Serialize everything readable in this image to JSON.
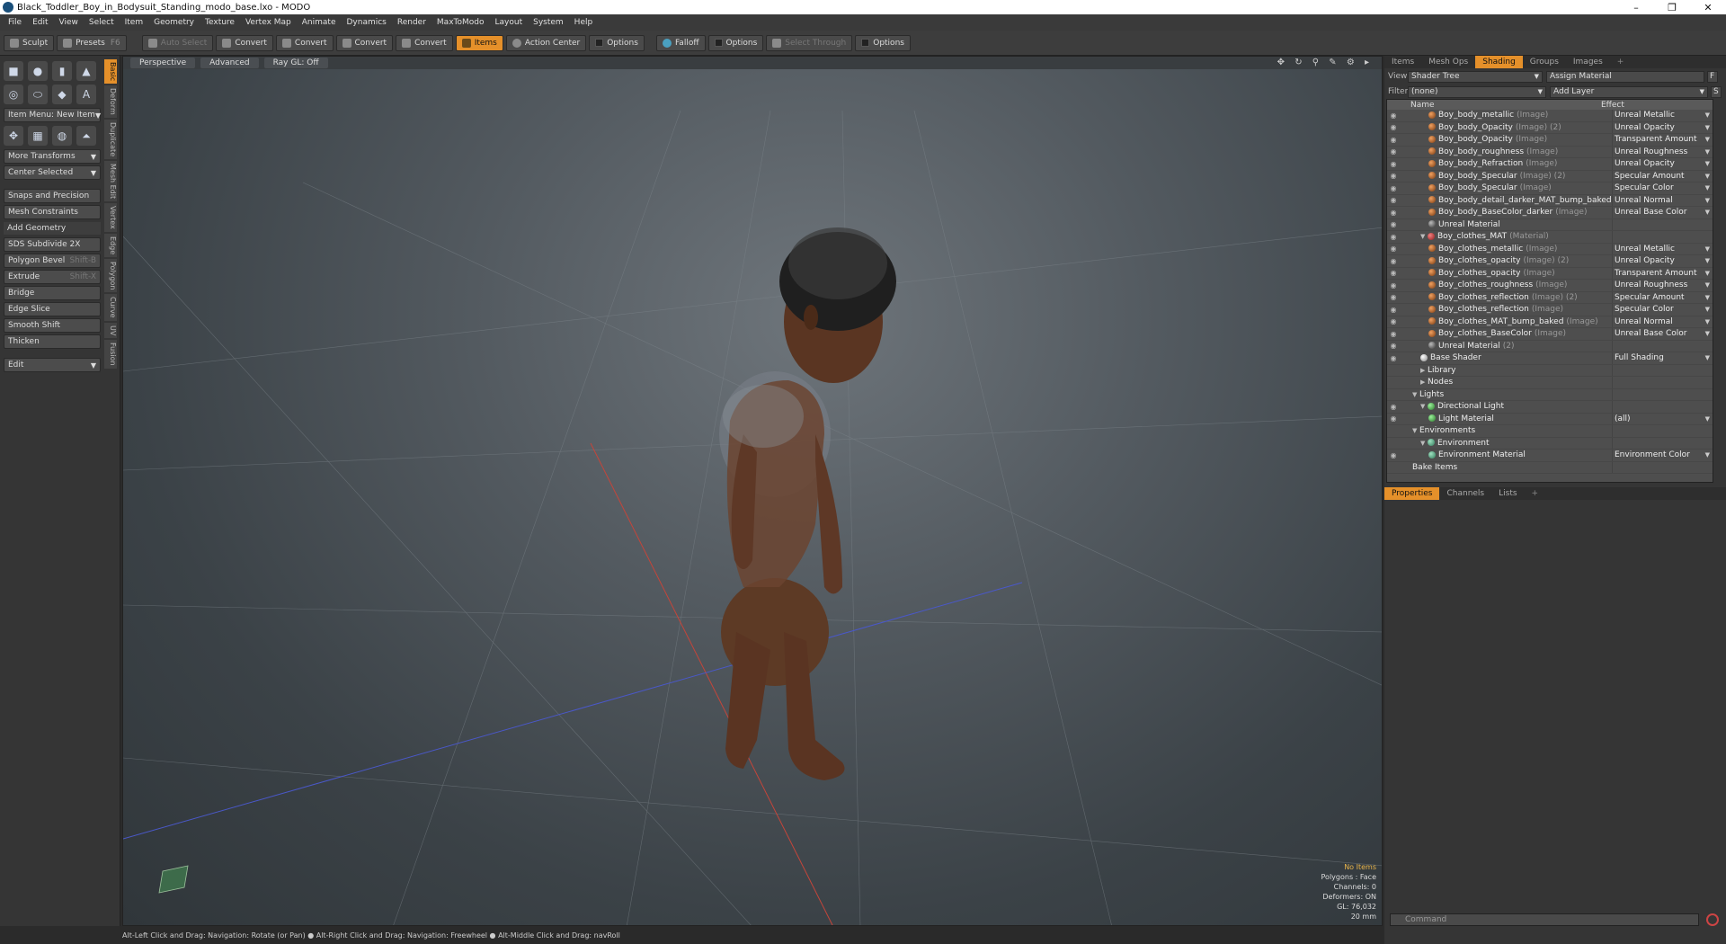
{
  "window": {
    "title": "Black_Toddler_Boy_in_Bodysuit_Standing_modo_base.lxo - MODO",
    "min": "–",
    "max": "❐",
    "close": "✕"
  },
  "menu": [
    "File",
    "Edit",
    "View",
    "Select",
    "Item",
    "Geometry",
    "Texture",
    "Vertex Map",
    "Animate",
    "Dynamics",
    "Render",
    "MaxToModo",
    "Layout",
    "System",
    "Help"
  ],
  "toolbar": {
    "sculpt": "Sculpt",
    "presets": "Presets",
    "presets_key": "F6",
    "auto_select": "Auto Select",
    "convert1": "Convert",
    "convert2": "Convert",
    "convert3": "Convert",
    "convert4": "Convert",
    "items": "Items",
    "action_center": "Action Center",
    "options1": "Options",
    "falloff": "Falloff",
    "options2": "Options",
    "select_through": "Select Through",
    "options3": "Options"
  },
  "left": {
    "item_menu": "Item Menu: New Item",
    "more_transforms": "More Transforms",
    "center_selected": "Center Selected",
    "snaps": "Snaps and Precision",
    "mesh_constraints": "Mesh Constraints",
    "add_geometry": "Add Geometry",
    "sds": "SDS Subdivide 2X",
    "polygon_bevel": "Polygon Bevel",
    "polygon_bevel_key": "Shift-B",
    "extrude": "Extrude",
    "extrude_key": "Shift-X",
    "bridge": "Bridge",
    "edge_slice": "Edge Slice",
    "smooth_shift": "Smooth Shift",
    "thicken": "Thicken",
    "edit": "Edit",
    "vtabs": [
      "Basic",
      "Deform",
      "Duplicate",
      "Mesh Edit",
      "Vertex",
      "Edge",
      "Polygon",
      "Curve",
      "UV",
      "Fusion"
    ]
  },
  "viewport": {
    "view": "Perspective",
    "mode": "Advanced",
    "raygl": "Ray GL: Off",
    "info": {
      "no_items": "No Items",
      "polygons": "Polygons : Face",
      "channels": "Channels: 0",
      "deformers": "Deformers: ON",
      "gl": "GL: 76,032",
      "mm": "20 mm"
    }
  },
  "status": "Alt-Left Click and Drag: Navigation: Rotate (or Pan) ● Alt-Right Click and Drag: Navigation: Freewheel ● Alt-Middle Click and Drag: navRoll",
  "right": {
    "tabs": [
      "Items",
      "Mesh Ops",
      "Shading",
      "Groups",
      "Images"
    ],
    "view_label": "View",
    "view_value": "Shader Tree",
    "assign": "Assign Material",
    "f_btn": "F",
    "filter_label": "Filter",
    "filter_value": "(none)",
    "add_layer": "Add Layer",
    "s_btn": "S",
    "col_name": "Name",
    "col_effect": "Effect",
    "rows": [
      {
        "indent": 2,
        "icon": "tex",
        "name": "Boy_body_metallic",
        "sub": "(Image)",
        "effect": "Unreal Metallic",
        "eye": true
      },
      {
        "indent": 2,
        "icon": "tex",
        "name": "Boy_body_Opacity",
        "sub": "(Image) (2)",
        "effect": "Unreal Opacity",
        "eye": true
      },
      {
        "indent": 2,
        "icon": "tex",
        "name": "Boy_body_Opacity",
        "sub": "(Image)",
        "effect": "Transparent Amount",
        "eye": true
      },
      {
        "indent": 2,
        "icon": "tex",
        "name": "Boy_body_roughness",
        "sub": "(Image)",
        "effect": "Unreal Roughness",
        "eye": true
      },
      {
        "indent": 2,
        "icon": "tex",
        "name": "Boy_body_Refraction",
        "sub": "(Image)",
        "effect": "Unreal Opacity",
        "eye": true
      },
      {
        "indent": 2,
        "icon": "tex",
        "name": "Boy_body_Specular",
        "sub": "(Image) (2)",
        "effect": "Specular Amount",
        "eye": true
      },
      {
        "indent": 2,
        "icon": "tex",
        "name": "Boy_body_Specular",
        "sub": "(Image)",
        "effect": "Specular Color",
        "eye": true
      },
      {
        "indent": 2,
        "icon": "tex",
        "name": "Boy_body_detail_darker_MAT_bump_baked ...",
        "sub": "",
        "effect": "Unreal Normal",
        "eye": true
      },
      {
        "indent": 2,
        "icon": "tex",
        "name": "Boy_body_BaseColor_darker",
        "sub": "(Image)",
        "effect": "Unreal Base Color",
        "eye": true
      },
      {
        "indent": 2,
        "icon": "um",
        "name": "Unreal Material",
        "sub": "",
        "effect": "",
        "eye": true
      },
      {
        "indent": 1,
        "icon": "mat",
        "name": "Boy_clothes_MAT",
        "sub": "(Material)",
        "effect": "",
        "eye": true,
        "tri": "▼"
      },
      {
        "indent": 2,
        "icon": "tex",
        "name": "Boy_clothes_metallic",
        "sub": "(Image)",
        "effect": "Unreal Metallic",
        "eye": true
      },
      {
        "indent": 2,
        "icon": "tex",
        "name": "Boy_clothes_opacity",
        "sub": "(Image) (2)",
        "effect": "Unreal Opacity",
        "eye": true
      },
      {
        "indent": 2,
        "icon": "tex",
        "name": "Boy_clothes_opacity",
        "sub": "(Image)",
        "effect": "Transparent Amount",
        "eye": true
      },
      {
        "indent": 2,
        "icon": "tex",
        "name": "Boy_clothes_roughness",
        "sub": "(Image)",
        "effect": "Unreal Roughness",
        "eye": true
      },
      {
        "indent": 2,
        "icon": "tex",
        "name": "Boy_clothes_reflection",
        "sub": "(Image) (2)",
        "effect": "Specular Amount",
        "eye": true
      },
      {
        "indent": 2,
        "icon": "tex",
        "name": "Boy_clothes_reflection",
        "sub": "(Image)",
        "effect": "Specular Color",
        "eye": true
      },
      {
        "indent": 2,
        "icon": "tex",
        "name": "Boy_clothes_MAT_bump_baked",
        "sub": "(Image)",
        "effect": "Unreal Normal",
        "eye": true
      },
      {
        "indent": 2,
        "icon": "tex",
        "name": "Boy_clothes_BaseColor",
        "sub": "(Image)",
        "effect": "Unreal Base Color",
        "eye": true
      },
      {
        "indent": 2,
        "icon": "um",
        "name": "Unreal Material",
        "sub": "(2)",
        "effect": "",
        "eye": true
      },
      {
        "indent": 1,
        "icon": "sh",
        "name": "Base Shader",
        "sub": "",
        "effect": "Full Shading",
        "eye": true
      },
      {
        "indent": 1,
        "icon": "",
        "name": "Library",
        "sub": "",
        "effect": "",
        "eye": false,
        "tri": "▶"
      },
      {
        "indent": 1,
        "icon": "",
        "name": "Nodes",
        "sub": "",
        "effect": "",
        "eye": false,
        "tri": "▶"
      },
      {
        "indent": 0,
        "icon": "",
        "name": "Lights",
        "sub": "",
        "effect": "",
        "eye": false,
        "tri": "▼"
      },
      {
        "indent": 1,
        "icon": "lt",
        "name": "Directional Light",
        "sub": "",
        "effect": "",
        "eye": true,
        "tri": "▼"
      },
      {
        "indent": 2,
        "icon": "lt",
        "name": "Light Material",
        "sub": "",
        "effect": "(all)",
        "eye": true
      },
      {
        "indent": 0,
        "icon": "",
        "name": "Environments",
        "sub": "",
        "effect": "",
        "eye": false,
        "tri": "▼"
      },
      {
        "indent": 1,
        "icon": "env",
        "name": "Environment",
        "sub": "",
        "effect": "",
        "eye": false,
        "tri": "▼"
      },
      {
        "indent": 2,
        "icon": "env",
        "name": "Environment Material",
        "sub": "",
        "effect": "Environment Color",
        "eye": true
      },
      {
        "indent": 0,
        "icon": "",
        "name": "Bake Items",
        "sub": "",
        "effect": "",
        "eye": false
      }
    ],
    "ptabs": [
      "Properties",
      "Channels",
      "Lists"
    ],
    "command_placeholder": "Command"
  }
}
